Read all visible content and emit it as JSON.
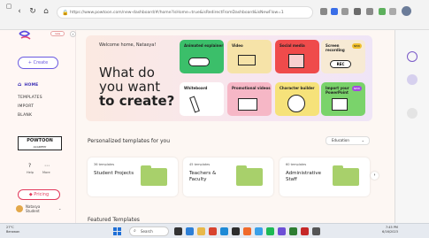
{
  "browser": {
    "url": "https://www.powtoon.com/new-dashboard/#/home?isHome=true&isRedirectFromDashboard&isNewFlow=1"
  },
  "sidebar": {
    "badge": "new",
    "create_label": "+ Create",
    "nav": [
      {
        "label": "HOME",
        "active": true
      },
      {
        "label": "TEMPLATES"
      },
      {
        "label": "IMPORT"
      },
      {
        "label": "BLANK"
      }
    ],
    "powtoon_label": "POWTOON",
    "powtoon_sub": "ACADEMY",
    "help_label": "Help",
    "more_label": "More",
    "pricing_label": "Pricing",
    "user_name": "Natasya",
    "user_sub": "Student"
  },
  "hero": {
    "welcome": "Welcome home, Natasya!",
    "headline_1": "What do",
    "headline_2": "you want",
    "headline_3": "to create?",
    "tiles": [
      {
        "label": "Animated explainer",
        "color": "#3bbf6a"
      },
      {
        "label": "Video",
        "color": "#f6e3a8"
      },
      {
        "label": "Social media",
        "color": "#ef4b4b"
      },
      {
        "label": "Screen recording",
        "color": "#f7ead4",
        "pill": "NEW"
      },
      {
        "label": "Whiteboard",
        "color": "#ffffff"
      },
      {
        "label": "Promotional videos",
        "color": "#f6b7c6"
      },
      {
        "label": "Character builder",
        "color": "#f6e27a"
      },
      {
        "label": "Import your PowerPoint",
        "color": "#7ad36b",
        "pill": "NEW"
      }
    ],
    "rec_label": "REC"
  },
  "personalized": {
    "title": "Personalized templates for you",
    "dropdown_value": "Education",
    "cards": [
      {
        "count": "36 templates",
        "title_1": "Student Projects",
        "title_2": ""
      },
      {
        "count": "45 templates",
        "title_1": "Teachers &",
        "title_2": "Faculty"
      },
      {
        "count": "60 templates",
        "title_1": "Administrative",
        "title_2": "Staff"
      }
    ]
  },
  "featured_title": "Featured Templates",
  "taskbar": {
    "weather_temp": "27°C",
    "weather_desc": "Berawan",
    "search_label": "Search",
    "time": "7:45 PM",
    "date": "6/16/2023"
  }
}
